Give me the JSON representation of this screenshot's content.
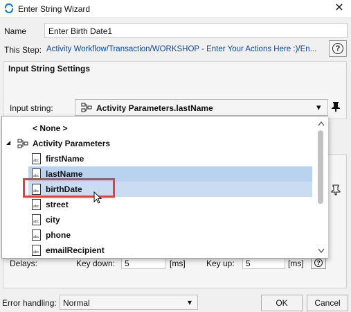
{
  "window": {
    "title": "Enter String Wizard",
    "close_glyph": "✕",
    "accent": "#1a7fd1"
  },
  "form": {
    "name_label": "Name",
    "name_value": "Enter Birth Date1",
    "step_label": "This Step:",
    "step_value": "Activity Workflow/Transaction/WORKSHOP - Enter Your Actions Here :)/En...",
    "help_glyph": "?"
  },
  "input_settings": {
    "group_title": "Input String Settings",
    "input_label": "Input string:",
    "selected_value": "Activity Parameters.lastName",
    "dropdown_glyph": "▾"
  },
  "dropdown": {
    "none_option": "< None >",
    "parent_label": "Activity Parameters",
    "expand_glyph": "◢",
    "items": [
      {
        "label": "firstName",
        "state": "normal"
      },
      {
        "label": "lastName",
        "state": "selected"
      },
      {
        "label": "birthDate",
        "state": "hover"
      },
      {
        "label": "street",
        "state": "normal"
      },
      {
        "label": "city",
        "state": "normal"
      },
      {
        "label": "phone",
        "state": "normal"
      },
      {
        "label": "emailRecipient",
        "state": "normal"
      }
    ],
    "item_icon_text": "abc",
    "highlight_color": "#c9dcf1",
    "selected_color": "#b9d3ee",
    "annotation_color": "#e0413c"
  },
  "delays": {
    "label": "Delays:",
    "key_down_label": "Key down:",
    "key_down_value": "5",
    "key_up_label": "Key up:",
    "key_up_value": "5",
    "unit": "[ms]"
  },
  "footer": {
    "error_label": "Error handling:",
    "error_value": "Normal",
    "ok_label": "OK",
    "cancel_label": "Cancel"
  }
}
